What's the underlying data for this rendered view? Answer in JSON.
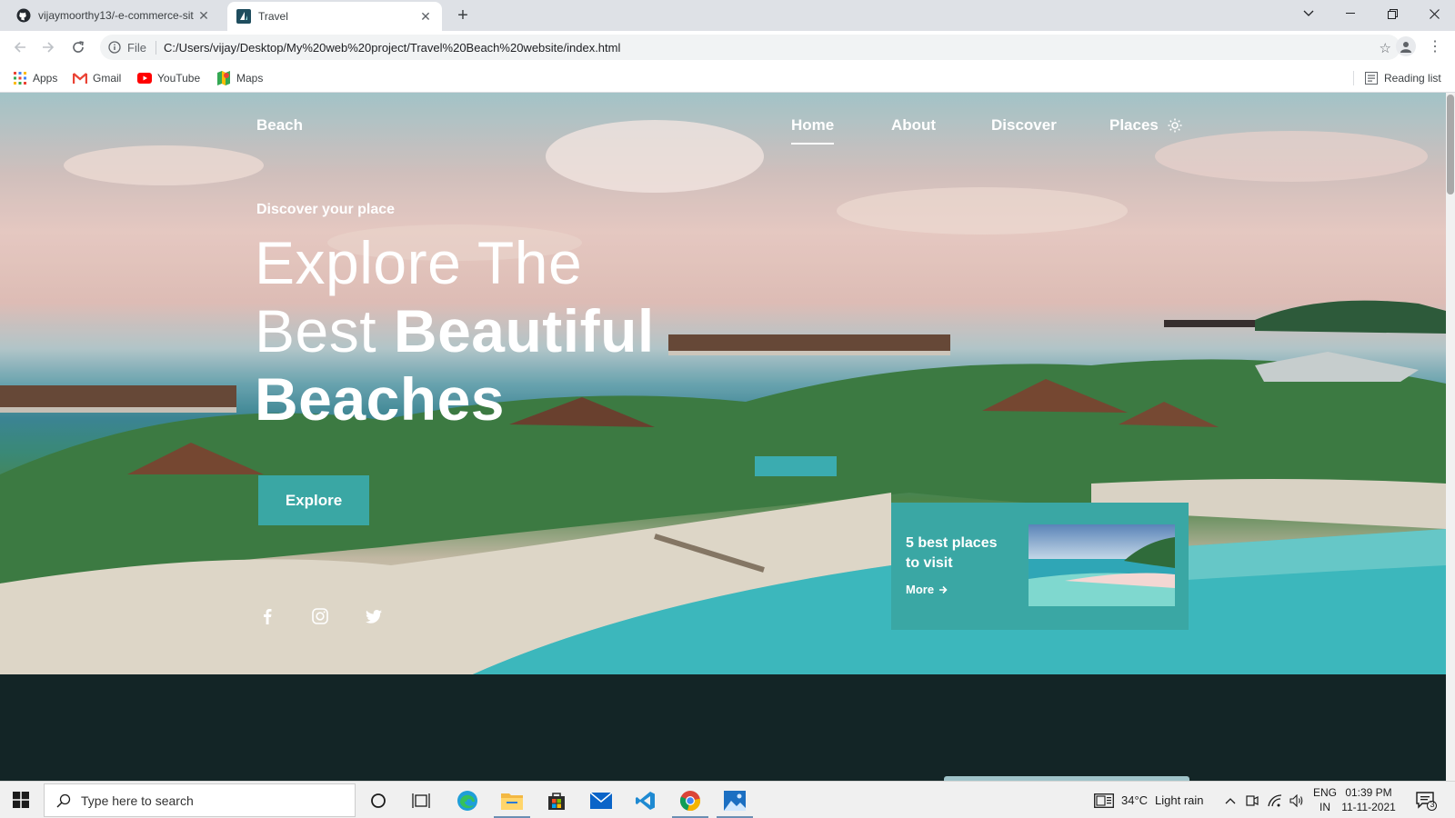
{
  "browser": {
    "tabs": [
      {
        "title": "vijaymoorthy13/-e-commerce-sit",
        "icon": "github-icon",
        "active": false
      },
      {
        "title": "Travel",
        "icon": "travel-favicon-icon",
        "active": true
      }
    ],
    "address": {
      "scheme": "File",
      "url": "C:/Users/vijay/Desktop/My%20web%20project/Travel%20Beach%20website/index.html"
    },
    "bookmarks": [
      {
        "label": "Apps",
        "icon": "apps-grid-icon"
      },
      {
        "label": "Gmail",
        "icon": "gmail-icon"
      },
      {
        "label": "YouTube",
        "icon": "youtube-icon"
      },
      {
        "label": "Maps",
        "icon": "maps-icon"
      }
    ],
    "reading_list": "Reading list"
  },
  "site": {
    "brand": "Beach",
    "nav": [
      {
        "label": "Home",
        "active": true
      },
      {
        "label": "About",
        "active": false
      },
      {
        "label": "Discover",
        "active": false
      },
      {
        "label": "Places",
        "active": false
      }
    ],
    "hero": {
      "subtitle": "Discover your place",
      "headline_thin_1": "Explore The",
      "headline_thin_2": "Best ",
      "headline_bold_1": "Beautiful",
      "headline_bold_2": "Beaches",
      "cta": "Explore"
    },
    "social": [
      "facebook-icon",
      "instagram-icon",
      "twitter-icon"
    ],
    "card": {
      "title": "5 best places to visit",
      "more": "More"
    },
    "colors": {
      "accent": "#3aa7a4",
      "dark_section": "#132526"
    }
  },
  "taskbar": {
    "search_placeholder": "Type here to search",
    "weather": {
      "temp": "34°C",
      "condition": "Light rain"
    },
    "lang": {
      "line1": "ENG",
      "line2": "IN"
    },
    "clock": {
      "time": "01:39 PM",
      "date": "11-11-2021"
    },
    "notifications": "3"
  }
}
